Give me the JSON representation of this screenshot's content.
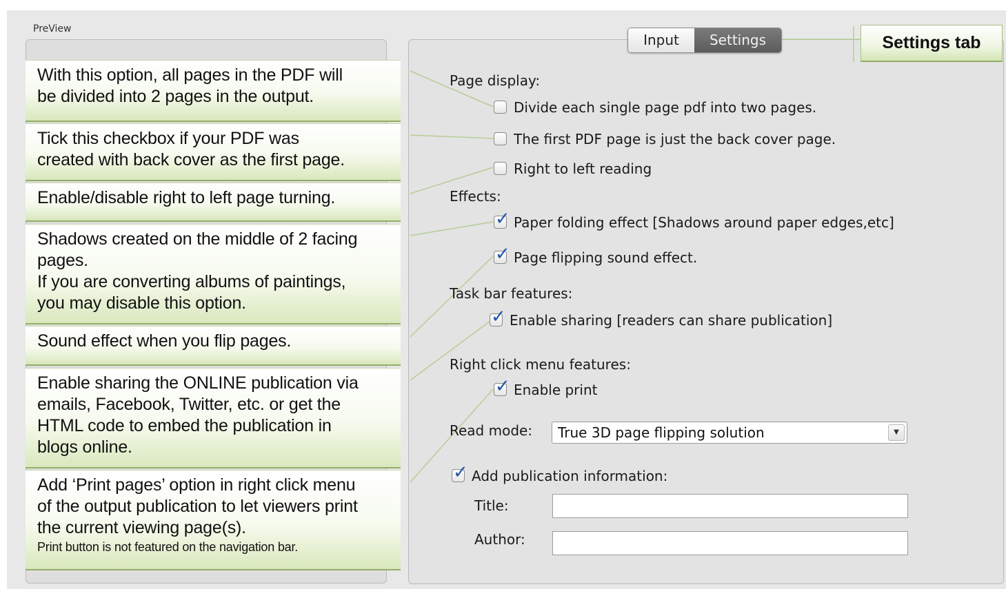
{
  "preview": {
    "title": "PreView"
  },
  "tabs": {
    "input_label": "Input",
    "settings_label": "Settings",
    "active": "Settings"
  },
  "settings_tab_callout": "Settings tab",
  "callouts": [
    {
      "lines": [
        "With this option, all pages in the PDF will",
        "be divided into 2 pages in the output."
      ]
    },
    {
      "lines": [
        "Tick this checkbox if your PDF was",
        "created with back cover as the first page."
      ]
    },
    {
      "lines": [
        "Enable/disable right to left page turning."
      ]
    },
    {
      "lines": [
        "Shadows created on the middle of 2 facing",
        "pages.",
        "If you are converting albums of paintings,",
        "you may disable this option."
      ]
    },
    {
      "lines": [
        "Sound effect when you flip pages."
      ]
    },
    {
      "lines": [
        "Enable sharing the ONLINE publication via",
        "emails, Facebook, Twitter, etc. or get the",
        "HTML code to embed the publication in",
        "blogs online."
      ]
    },
    {
      "lines": [
        "Add ‘Print pages’ option in right click menu",
        "of the output publication to let viewers print",
        "the current viewing page(s)."
      ],
      "note": "Print button is not featured on the navigation bar."
    }
  ],
  "settings": {
    "page_display_label": "Page display:",
    "divide_pages": {
      "label": "Divide each single page pdf into two pages.",
      "checked": false
    },
    "back_cover": {
      "label": "The first PDF page is just the back cover page.",
      "checked": false
    },
    "right_to_left": {
      "label": "Right to left reading",
      "checked": false
    },
    "effects_label": "Effects:",
    "paper_folding": {
      "label": "Paper folding effect [Shadows around paper edges,etc]",
      "checked": true
    },
    "flip_sound": {
      "label": "Page flipping sound effect.",
      "checked": true
    },
    "taskbar_label": "Task bar features:",
    "enable_sharing": {
      "label": "Enable sharing [readers can share publication]",
      "checked": true
    },
    "right_click_label": "Right click menu features:",
    "enable_print": {
      "label": "Enable print",
      "checked": true
    },
    "read_mode_label": "Read mode:",
    "read_mode_value": "True 3D page flipping solution",
    "add_pub_info": {
      "label": "Add publication information:",
      "checked": true
    },
    "title_label": "Title:",
    "title_value": "",
    "author_label": "Author:",
    "author_value": ""
  },
  "colors": {
    "callout_border": "#93ad67",
    "connector": "#b8cc96",
    "tab_active_bg": "#6b6b6b",
    "check": "#1d57a8"
  }
}
